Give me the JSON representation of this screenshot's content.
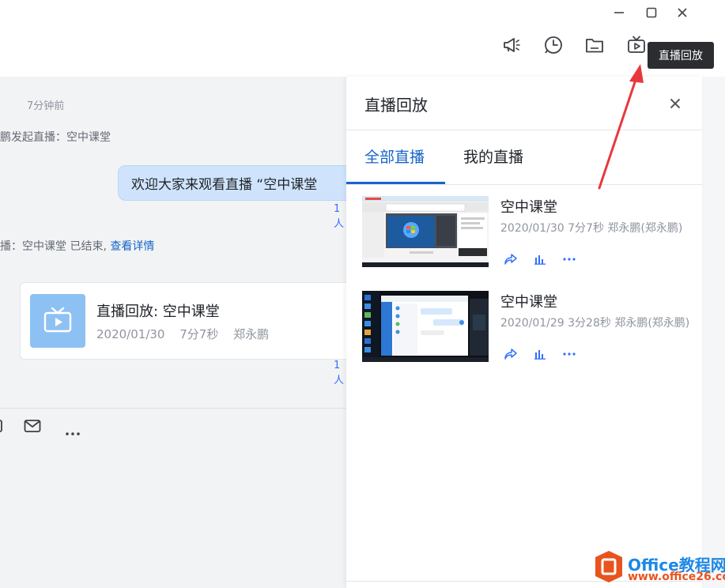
{
  "window": {
    "minimize_icon": "minimize-icon",
    "maximize_icon": "maximize-icon",
    "close_icon": "close-icon"
  },
  "toolbar": {
    "icons": [
      "announcement-icon",
      "history-icon",
      "folder-icon",
      "live-replay-icon"
    ],
    "tooltip": "直播回放"
  },
  "chat": {
    "time": "7分钟前",
    "system_start": "鹏发起直播：空中课堂",
    "bubble_text": "欢迎大家来观看直播 “空中课堂",
    "read_count_1": "1人",
    "system_end_prefix": "播：空中课堂 已结束,",
    "system_end_link": "查看详情",
    "card": {
      "title": "直播回放: 空中课堂",
      "date": "2020/01/30",
      "duration": "7分7秒",
      "host": "郑永鹏"
    },
    "read_count_2": "1人",
    "input_icons": [
      "mail-icon",
      "more-icon"
    ]
  },
  "panel": {
    "title": "直播回放",
    "tabs": [
      {
        "label": "全部直播",
        "active": true
      },
      {
        "label": "我的直播",
        "active": false
      }
    ],
    "items": [
      {
        "title": "空中课堂",
        "meta": "2020/01/30 7分7秒 郑永鹏(郑永鹏)"
      },
      {
        "title": "空中课堂",
        "meta": "2020/01/29 3分28秒 郑永鹏(郑永鹏)"
      }
    ],
    "actions": [
      "share-icon",
      "stats-icon",
      "more-icon"
    ]
  },
  "watermark": {
    "line1": "Office教程网",
    "line2": "www.office26.com"
  },
  "colors": {
    "accent": "#1664c7",
    "bubble": "#cfe4fc",
    "arrow": "#e8383d"
  }
}
